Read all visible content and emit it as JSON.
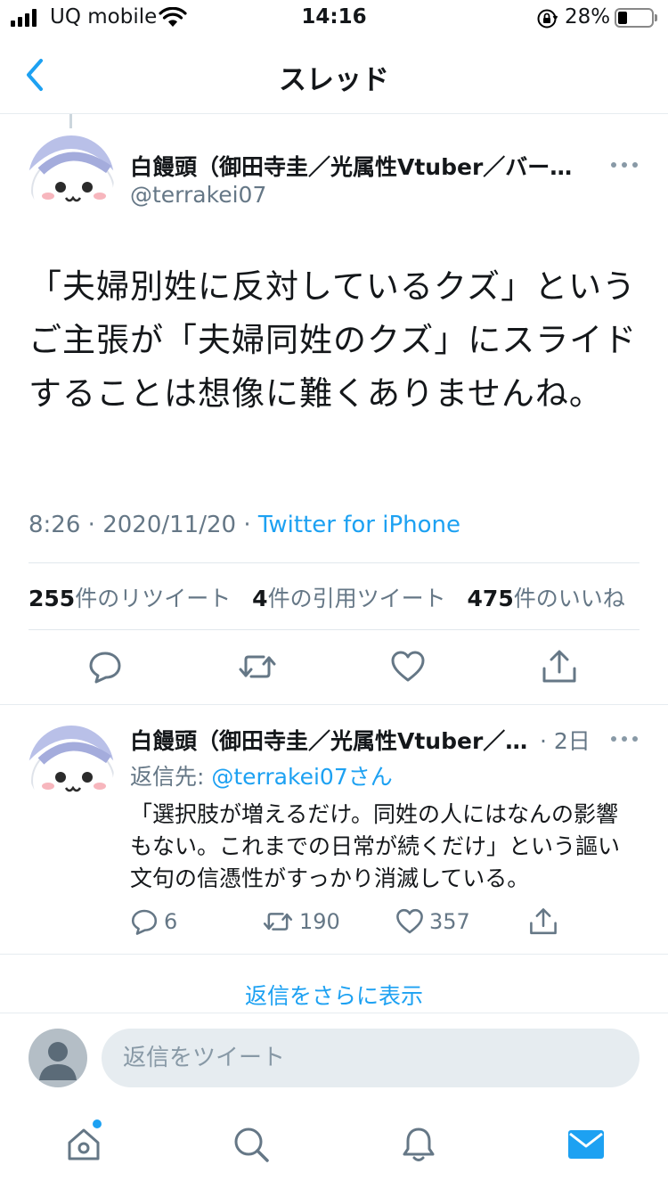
{
  "status_bar": {
    "carrier": "UQ mobile",
    "time": "14:16",
    "battery": "28%",
    "battery_level": 0.28
  },
  "nav": {
    "title": "スレッド",
    "back_icon": "chevron-left-icon"
  },
  "tweet": {
    "display_name": "白饅頭（御田寺圭／光属性Vtuber／バー…",
    "handle": "@terrakei07",
    "text": "「夫婦別姓に反対しているクズ」というご主張が「夫婦同姓のクズ」にスライドすることは想像に難くありませんね。",
    "time": "8:26",
    "date": "2020/11/20",
    "source": "Twitter for iPhone",
    "stats": {
      "retweets_count": "255",
      "retweets_label": "件のリツイート",
      "quotes_count": "4",
      "quotes_label": "件の引用ツイート",
      "likes_count": "475",
      "likes_label": "件のいいね"
    }
  },
  "reply": {
    "display_name": "白饅頭（御田寺圭／光属性Vtuber／…",
    "age": "2日",
    "reply_to_prefix": "返信先: ",
    "reply_to_handle": "@terrakei07さん",
    "text": "「選択肢が増えるだけ。同姓の人にはなんの影響もない。これまでの日常が続くだけ」という謳い文句の信憑性がすっかり消滅している。",
    "reply_count": "6",
    "retweet_count": "190",
    "like_count": "357"
  },
  "show_more_label": "返信をさらに表示",
  "compose": {
    "placeholder": "返信をツイート"
  },
  "tab_bar": {
    "items": [
      "home-icon",
      "search-icon",
      "notifications-icon",
      "messages-icon"
    ],
    "active_color": "#1da1f2"
  },
  "colors": {
    "accent": "#1da1f2",
    "secondary_text": "#657786",
    "divider": "#e1e8ed"
  }
}
